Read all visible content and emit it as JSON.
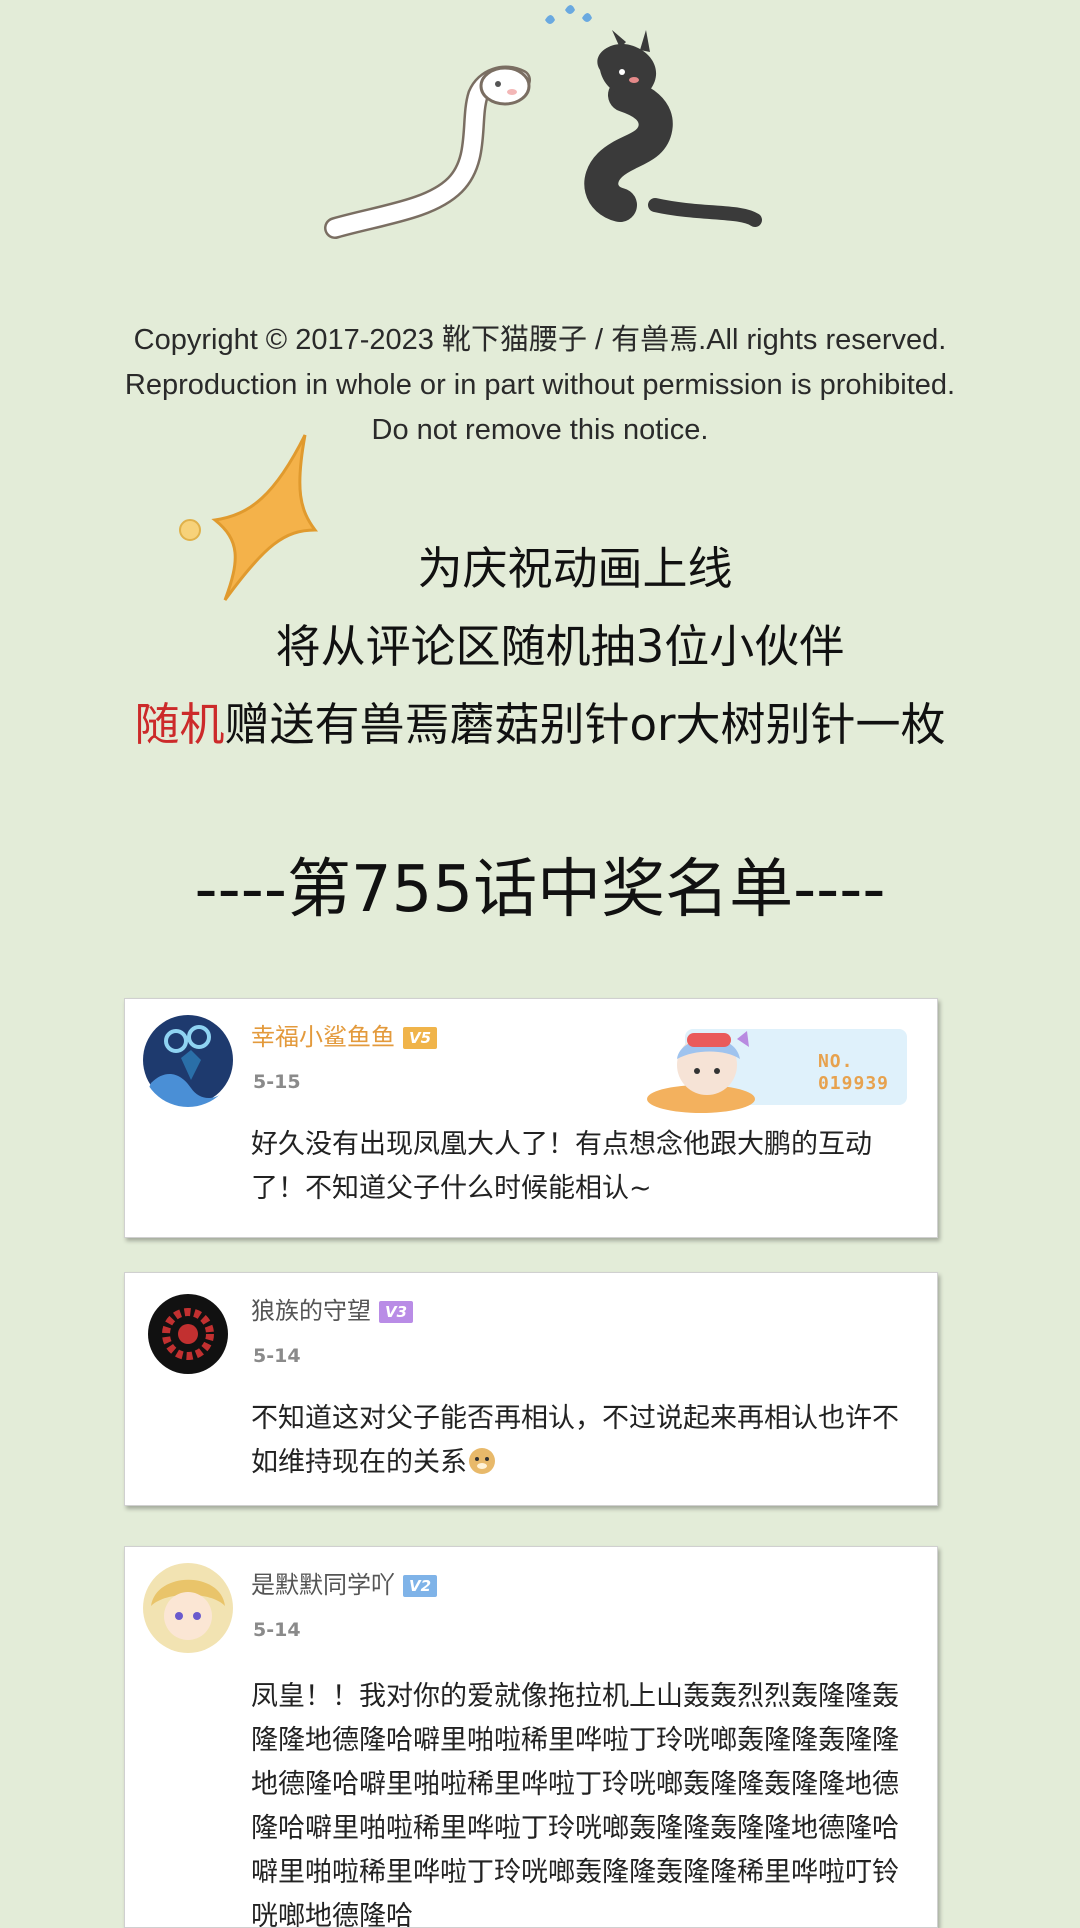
{
  "copyright": {
    "line1": "Copyright © 2017-2023 靴下猫腰子 / 有兽焉.All rights reserved.",
    "line2": "Reproduction in whole or in part without permission is prohibited.",
    "line3": "Do not remove this notice."
  },
  "announcement": {
    "line1": "为庆祝动画上线",
    "line2": "将从评论区随机抽3位小伙伴",
    "line3_highlight": "随机",
    "line3_rest": "赠送有兽焉蘑菇别针or大树别针一枚"
  },
  "winners_title": "----第755话中奖名单----",
  "comments": [
    {
      "username": "幸福小鲨鱼鱼",
      "level": "V5",
      "level_color": "#f0b44a",
      "username_color": "#e39a3c",
      "date": "5-15",
      "badge_no_label": "NO.",
      "badge_no_value": "019939",
      "text": "好久没有出现凤凰大人了！有点想念他跟大鹏的互动了！不知道父子什么时候能相认~"
    },
    {
      "username": "狼族的守望",
      "level": "V3",
      "level_color": "#b98ce6",
      "username_color": "#555555",
      "date": "5-14",
      "text": "不知道这对父子能否再相认，不过说起来再相认也许不如维持现在的关系"
    },
    {
      "username": "是默默同学吖",
      "level": "V2",
      "level_color": "#7fb3e8",
      "username_color": "#555555",
      "date": "5-14",
      "text": "凤皇！！我对你的爱就像拖拉机上山轰轰烈烈轰隆隆轰隆隆地德隆哈噼里啪啦稀里哗啦丁玲咣啷轰隆隆轰隆隆地德隆哈噼里啪啦稀里哗啦丁玲咣啷轰隆隆轰隆隆地德隆哈噼里啪啦稀里哗啦丁玲咣啷轰隆隆轰隆隆地德隆哈噼里啪啦稀里哗啦丁玲咣啷轰隆隆轰隆隆稀里哗啦叮铃咣啷地德隆哈"
    }
  ]
}
